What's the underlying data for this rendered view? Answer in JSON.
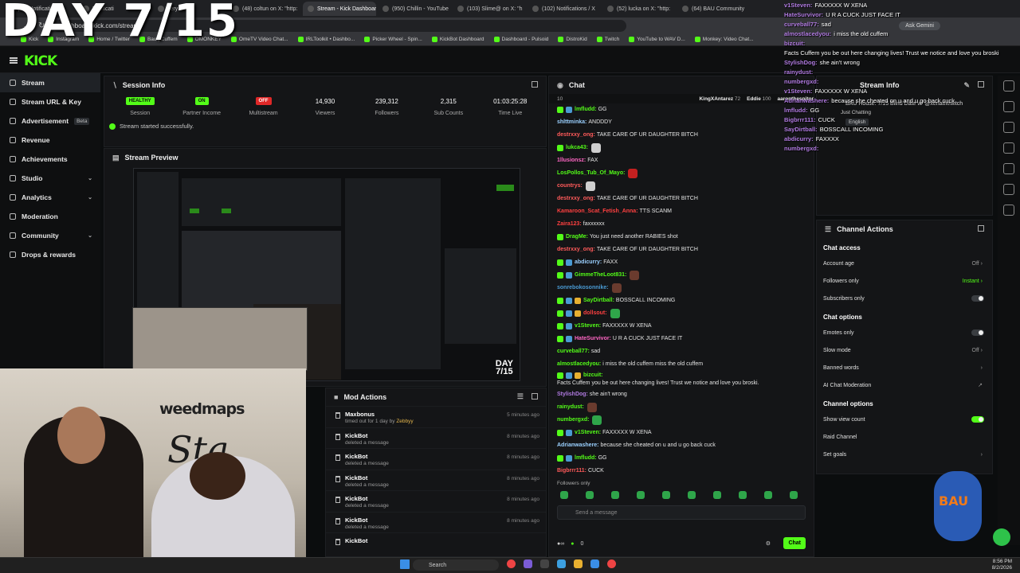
{
  "overlay": {
    "day": "DAY 7/15"
  },
  "browser": {
    "tabs": [
      "(49) Notificati",
      "Notificati",
      "kery on",
      "(48) coltun on X: \"http:",
      "Stream - Kick Dashboar",
      "(950) Chillin - YouTube",
      "(103) Slime@ on X: \"h",
      "(102) Notifications / X",
      "(52) lucka on X: \"http:",
      "(64) BAU Community"
    ],
    "url": "dashboard.kick.com/stream",
    "bookmarks": [
      "Kick",
      "Instagram",
      "Home / Twitter",
      "Bau | Cuffem",
      "OMONKEY",
      "OmeTV Video Chat...",
      "IRLToolkit • Dashbo...",
      "Picker Wheel - Spin...",
      "KickBot Dashboard",
      "Dashboard - Pulsoid",
      "DistroKid",
      "Twitch",
      "YouTube to WAV D...",
      "Monkey: Video Chat..."
    ],
    "ask_gemini": "Ask Gemini"
  },
  "sidebar": {
    "items": [
      {
        "label": "Stream"
      },
      {
        "label": "Stream URL & Key"
      },
      {
        "label": "Advertisement",
        "badge": "Beta"
      },
      {
        "label": "Revenue"
      },
      {
        "label": "Achievements"
      },
      {
        "label": "Studio"
      },
      {
        "label": "Analytics"
      },
      {
        "label": "Moderation"
      },
      {
        "label": "Community"
      },
      {
        "label": "Drops & rewards"
      }
    ]
  },
  "session": {
    "title": "Session Info",
    "stats": [
      {
        "pill": "HEALTHY",
        "label": "Session"
      },
      {
        "pill": "ON",
        "label": "Partner Income"
      },
      {
        "pill": "OFF",
        "label": "Multistream"
      },
      {
        "value": "14,930",
        "label": "Viewers"
      },
      {
        "value": "239,312",
        "label": "Followers"
      },
      {
        "value": "2,315",
        "label": "Sub Counts"
      },
      {
        "value": "01:03:25:28",
        "label": "Time Live"
      }
    ],
    "status": "Stream started successfully."
  },
  "preview": {
    "title": "Stream Preview",
    "day_top": "DAY",
    "day_bottom": "7/15"
  },
  "mod": {
    "title": "Mod Actions",
    "rows": [
      {
        "name": "Maxbonus",
        "desc": "timed out for 1 day by",
        "by": "Zebbyy",
        "time": "5 minutes ago"
      },
      {
        "name": "KickBot",
        "desc": "deleted a message",
        "time": "8 minutes ago"
      },
      {
        "name": "KickBot",
        "desc": "deleted a message",
        "time": "8 minutes ago"
      },
      {
        "name": "KickBot",
        "desc": "deleted a message",
        "time": "8 minutes ago"
      },
      {
        "name": "KickBot",
        "desc": "deleted a message",
        "time": "8 minutes ago"
      },
      {
        "name": "KickBot",
        "desc": "deleted a message",
        "time": "8 minutes ago"
      },
      {
        "name": "KickBot",
        "desc": "",
        "time": ""
      }
    ]
  },
  "chat": {
    "title": "Chat",
    "pinned": [
      {
        "name": "KingXAntarez",
        "n": "72"
      },
      {
        "name": "Eddie",
        "n": "100"
      },
      {
        "name": "aaronthesnitor",
        "n": ""
      }
    ],
    "lines": [
      {
        "user": "lmfludd",
        "color": "#53fc18",
        "msg": "GG",
        "badges": 2
      },
      {
        "user": "shlttminka",
        "color": "#9ad0ff",
        "msg": "ANDDDY"
      },
      {
        "user": "destrxxy_ong",
        "color": "#ff5a5a",
        "msg": "TAKE CARE OF UR DAUGHTER BITCH"
      },
      {
        "user": "lukca43",
        "color": "#53fc18",
        "msg": "",
        "emote": "w",
        "badges": 1
      },
      {
        "user": "1llusionsz",
        "color": "#ff66c4",
        "msg": "FAX"
      },
      {
        "user": "LosPollos_Tub_Of_Mayo",
        "color": "#53fc18",
        "msg": "",
        "emote": "r"
      },
      {
        "user": "countrys",
        "color": "#ff5a5a",
        "msg": "",
        "emote": "w"
      },
      {
        "user": "destrxxy_ong",
        "color": "#ff5a5a",
        "msg": "TAKE CARE OF UR DAUGHTER BITCH"
      },
      {
        "user": "Kamaroon_Scat_Fetish_Anna",
        "color": "#ff4040",
        "msg": "TTS SCANM"
      },
      {
        "user": "Zaira123",
        "color": "#ff4040",
        "msg": "faxxxxxx"
      },
      {
        "user": "DragMe",
        "color": "#53fc18",
        "msg": "You just need another RABIES shot",
        "badges": 1
      },
      {
        "user": "destrxxy_ong",
        "color": "#ff5a5a",
        "msg": "TAKE CARE OF UR DAUGHTER BITCH"
      },
      {
        "user": "abdicurry",
        "color": "#9ad0ff",
        "msg": "FAXX",
        "badges": 2
      },
      {
        "user": "GimmeTheLoot831",
        "color": "#53fc18",
        "msg": "",
        "emote": "",
        "badges": 2
      },
      {
        "user": "sonrebokosonnike",
        "color": "#4a9bd4",
        "msg": "",
        "emote": "y"
      },
      {
        "user": "SayDirtball",
        "color": "#53fc18",
        "msg": "BOSSCALL INCOMING",
        "badges": 3
      },
      {
        "user": "dollsout",
        "color": "#ff4040",
        "msg": "",
        "emote": "g",
        "badges": 3
      },
      {
        "user": "v1Steven",
        "color": "#53fc18",
        "msg": "FAXXXXX W XENA",
        "badges": 2
      },
      {
        "user": "HateSurvivor",
        "color": "#ff66c4",
        "msg": "U R A CUCK JUST FACE IT",
        "badges": 2
      },
      {
        "user": "curveball77",
        "color": "#53fc18",
        "msg": "sad"
      },
      {
        "user": "almostlacedyou",
        "color": "#53fc18",
        "msg": "i miss the old cuffem     miss the old cuffem"
      },
      {
        "user": "bizcuit",
        "color": "#53fc18",
        "msg": "Facts Cuffem you be out here changing lives! Trust we notice and love you broski.",
        "badges": 3
      },
      {
        "user": "StylishDog",
        "color": "#b07ae0",
        "msg": "she ain't wrong"
      },
      {
        "user": "rainydust",
        "color": "#53fc18",
        "msg": "",
        "emote": "y"
      },
      {
        "user": "numbergxd",
        "color": "#53fc18",
        "msg": "",
        "emote": "g"
      },
      {
        "user": "v1Steven",
        "color": "#53fc18",
        "msg": "FAXXXXX W XENA",
        "badges": 2
      },
      {
        "user": "Adrianwashere",
        "color": "#9ad0ff",
        "msg": "because she cheated on u and u go back cuck"
      },
      {
        "user": "lmfludd",
        "color": "#53fc18",
        "msg": "GG",
        "badges": 2
      },
      {
        "user": "Bigbrrr111",
        "color": "#ff5a5a",
        "msg": "CUCK"
      }
    ],
    "followers_only": "Followers only",
    "placeholder": "Send a message",
    "count": "0",
    "chat_button": "Chat"
  },
  "streaminfo": {
    "title": "Stream Info",
    "stream_title": "BAU House: 7/15 Blind Date w/ @xenathewitch",
    "category": "Just Chatting",
    "language": "English"
  },
  "overlay_chat": [
    {
      "user": "v1Steven",
      "msg": "FAXXXXX W XENA"
    },
    {
      "user": "HateSurvivor",
      "msg": "U R A CUCK JUST FACE IT"
    },
    {
      "user": "curveball77",
      "msg": "sad"
    },
    {
      "user": "almostlacedyou",
      "msg": "i miss the old cuffem"
    },
    {
      "user": "bizcuit",
      "msg": "Facts Cuffem you be out here changing lives! Trust we notice and love you broski"
    },
    {
      "user": "StylishDog",
      "msg": "she ain't wrong"
    },
    {
      "user": "rainydust",
      "msg": ""
    },
    {
      "user": "numbergxd",
      "msg": ""
    },
    {
      "user": "v1Steven",
      "msg": "FAXXXXX W XENA"
    },
    {
      "user": "Adrianwashere",
      "msg": "because she cheated on u and u go back cuck"
    },
    {
      "user": "lmfludd",
      "msg": "GG"
    },
    {
      "user": "Bigbrrr111",
      "msg": "CUCK"
    },
    {
      "user": "SayDirtball",
      "msg": "BOSSCALL INCOMING"
    },
    {
      "user": "abdicurry",
      "msg": "FAXXXX"
    },
    {
      "user": "numbergxd",
      "msg": ""
    }
  ],
  "channel": {
    "title": "Channel Actions",
    "sections": [
      {
        "title": "Chat access",
        "rows": [
          {
            "label": "Account age",
            "value": "Off",
            "kind": "arrow"
          },
          {
            "label": "Followers only",
            "value": "Instant",
            "kind": "arrow-green"
          },
          {
            "label": "Subscribers only",
            "kind": "toggle-off"
          }
        ]
      },
      {
        "title": "Chat options",
        "rows": [
          {
            "label": "Emotes only",
            "kind": "toggle-off"
          },
          {
            "label": "Slow mode",
            "value": "Off",
            "kind": "arrow"
          },
          {
            "label": "Banned words",
            "kind": "arrow"
          },
          {
            "label": "AI Chat Moderation",
            "kind": "ext"
          }
        ]
      },
      {
        "title": "Channel options",
        "rows": [
          {
            "label": "Show view count",
            "kind": "toggle-on"
          },
          {
            "label": "Raid Channel",
            "kind": "none"
          },
          {
            "label": "Set goals",
            "kind": "arrow"
          }
        ]
      }
    ]
  },
  "taskbar": {
    "search": "Search",
    "time": "8:56 PM",
    "date": "8/2/2026"
  },
  "mascot": {
    "text": "BAU"
  }
}
